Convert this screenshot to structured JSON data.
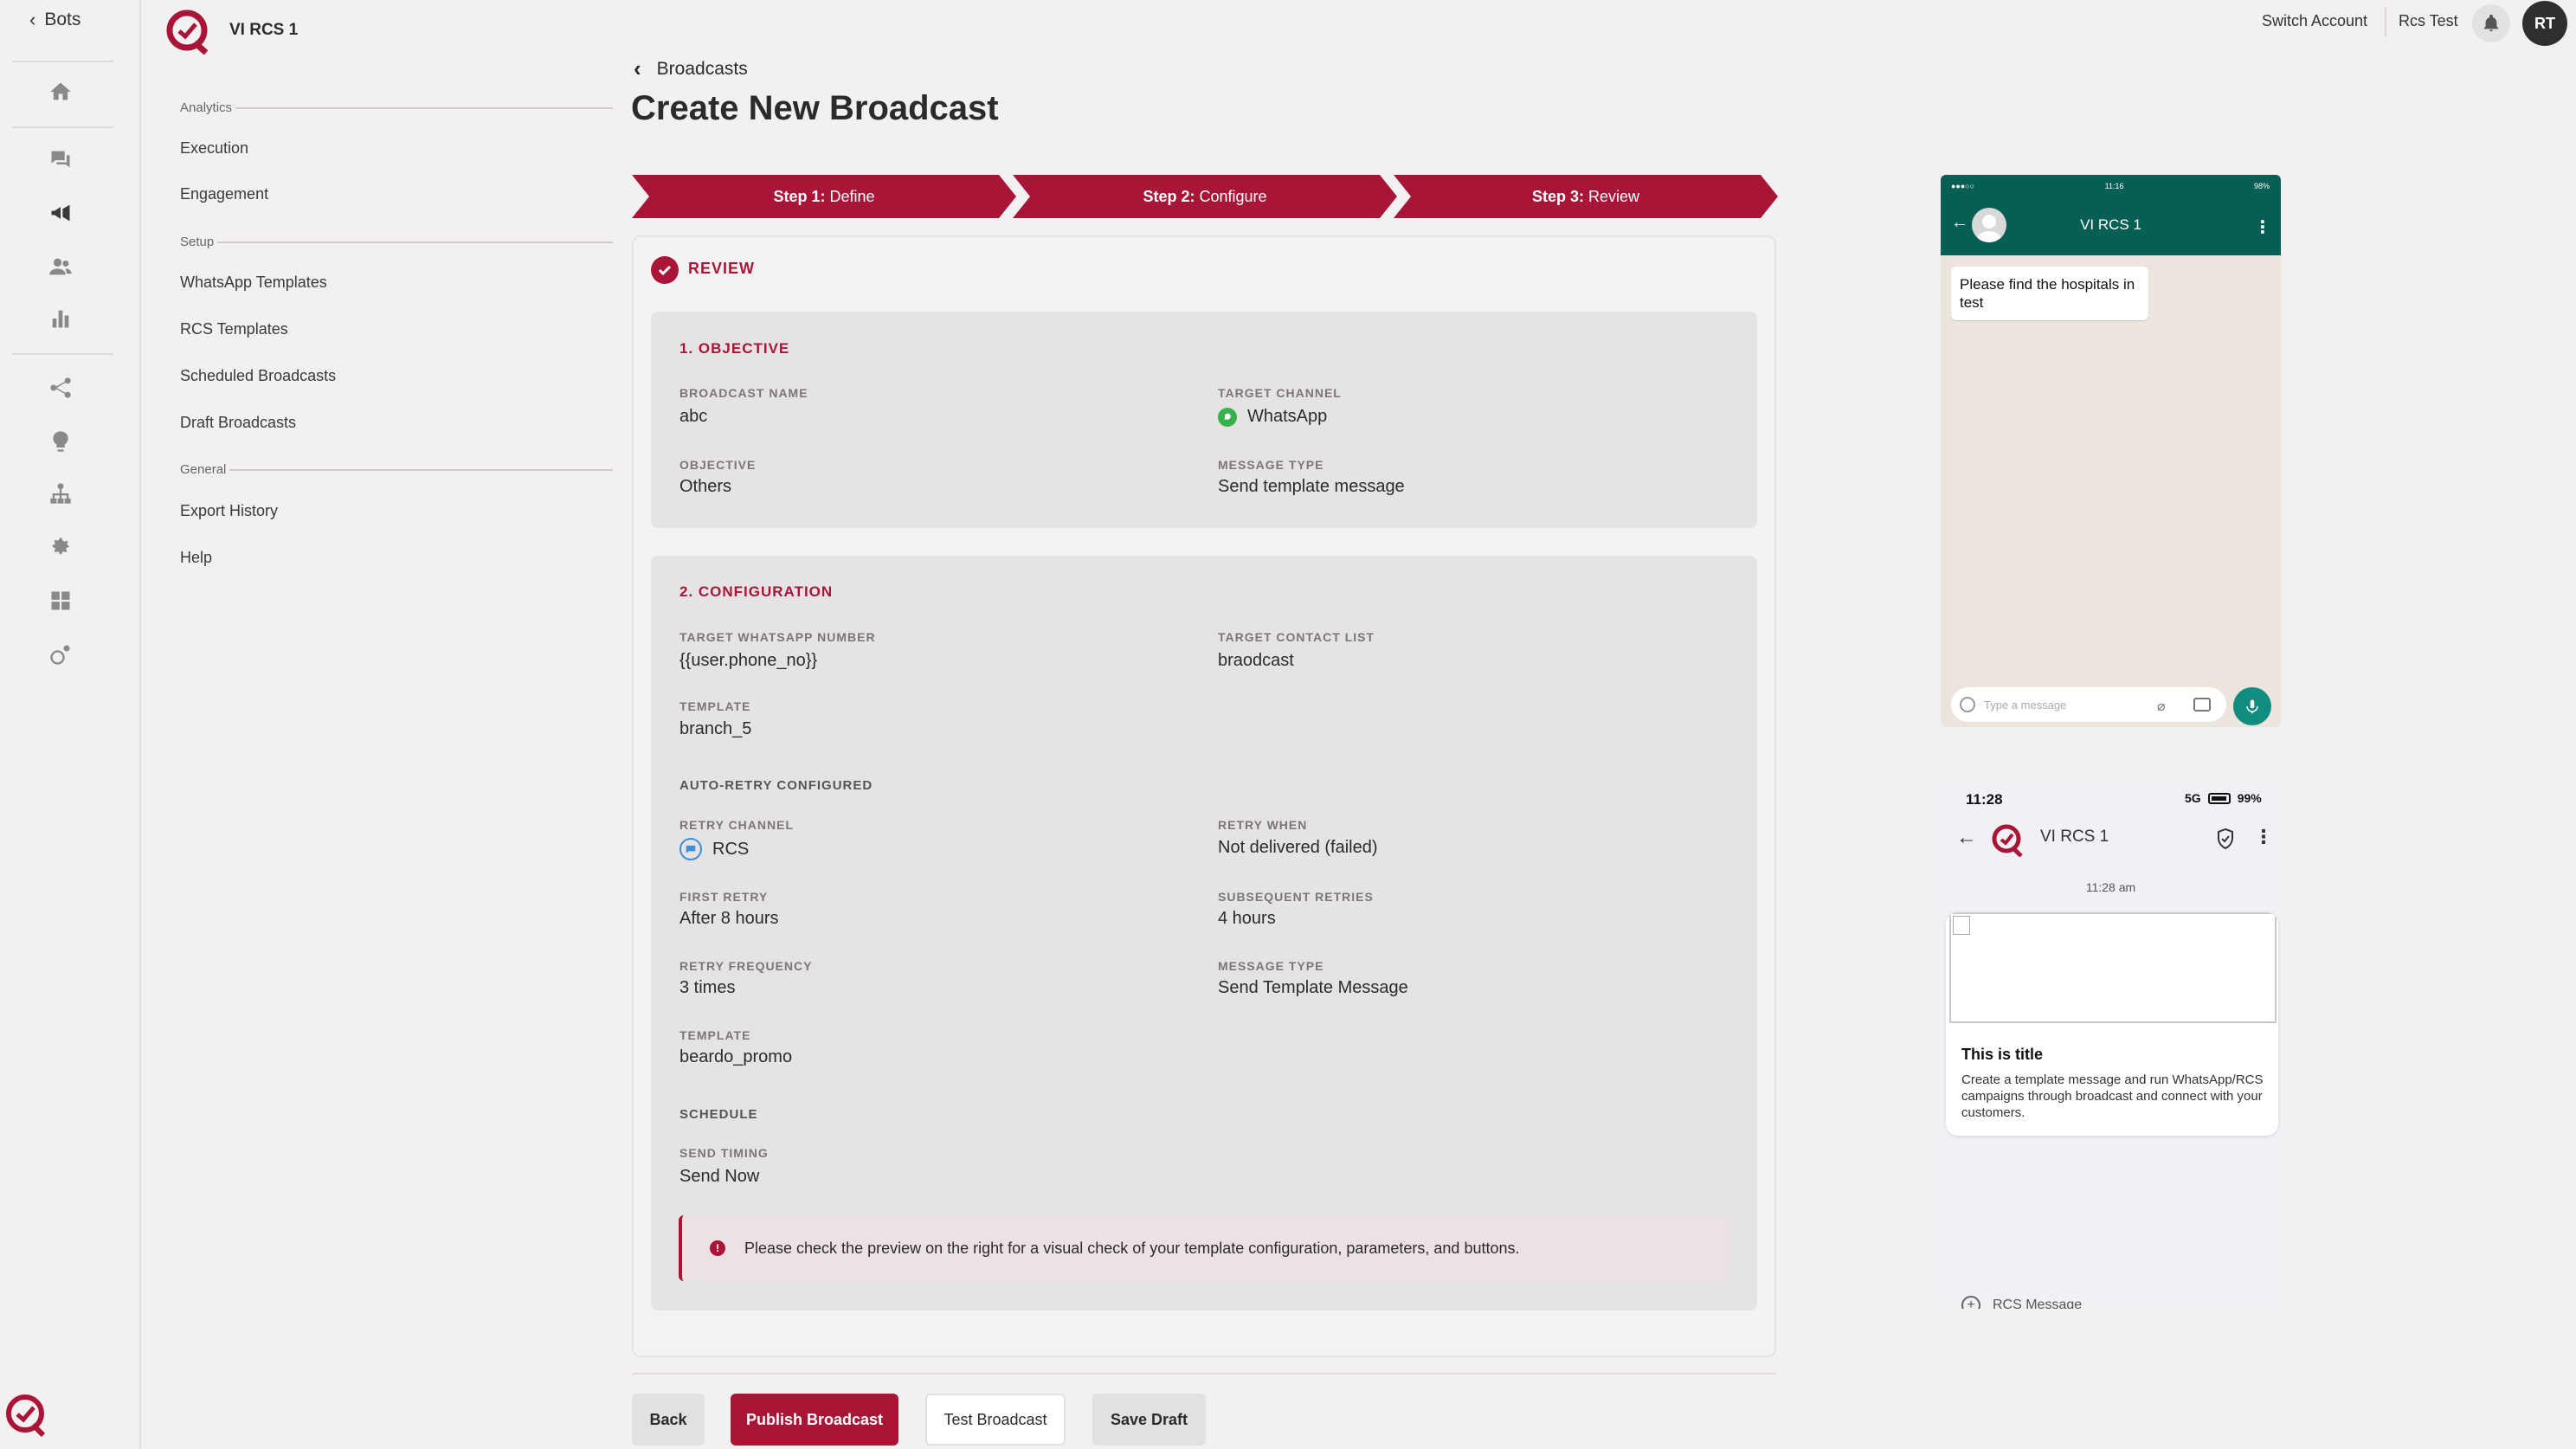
{
  "rail": {
    "back_label": "Bots"
  },
  "sidebar": {
    "bot_name": "VI RCS 1",
    "sections": {
      "analytics": "Analytics",
      "setup": "Setup",
      "general": "General"
    },
    "items": {
      "execution": "Execution",
      "engagement": "Engagement",
      "whatsapp_templates": "WhatsApp Templates",
      "rcs_templates": "RCS Templates",
      "scheduled_broadcasts": "Scheduled Broadcasts",
      "draft_broadcasts": "Draft Broadcasts",
      "export_history": "Export History",
      "help": "Help"
    }
  },
  "header": {
    "switch_account": "Switch Account",
    "account_name": "Rcs Test",
    "avatar_initials": "RT"
  },
  "main": {
    "breadcrumb": "Broadcasts",
    "title": "Create New Broadcast",
    "steps": [
      {
        "prefix": "Step 1:",
        "label": "Define"
      },
      {
        "prefix": "Step 2:",
        "label": "Configure"
      },
      {
        "prefix": "Step 3:",
        "label": "Review"
      }
    ],
    "review_title": "REVIEW",
    "objective": {
      "title": "1. OBJECTIVE",
      "broadcast_name_label": "BROADCAST NAME",
      "broadcast_name": "abc",
      "target_channel_label": "TARGET CHANNEL",
      "target_channel": "WhatsApp",
      "objective_label": "OBJECTIVE",
      "objective": "Others",
      "message_type_label": "MESSAGE TYPE",
      "message_type": "Send template message"
    },
    "configuration": {
      "title": "2. CONFIGURATION",
      "target_number_label": "TARGET WHATSAPP NUMBER",
      "target_number": "{{user.phone_no}}",
      "target_list_label": "TARGET CONTACT LIST",
      "target_list": "braodcast",
      "template_label": "TEMPLATE",
      "template": "branch_5",
      "auto_retry_heading": "AUTO-RETRY CONFIGURED",
      "retry_channel_label": "RETRY CHANNEL",
      "retry_channel": "RCS",
      "retry_when_label": "RETRY WHEN",
      "retry_when": "Not delivered (failed)",
      "first_retry_label": "FIRST RETRY",
      "first_retry": "After 8 hours",
      "subsequent_label": "SUBSEQUENT RETRIES",
      "subsequent": "4 hours",
      "frequency_label": "RETRY FREQUENCY",
      "frequency": "3 times",
      "retry_msg_type_label": "MESSAGE TYPE",
      "retry_msg_type": "Send Template Message",
      "retry_template_label": "TEMPLATE",
      "retry_template": "beardo_promo",
      "schedule_heading": "SCHEDULE",
      "send_timing_label": "SEND TIMING",
      "send_timing": "Send Now"
    },
    "alert": "Please check the preview on the right for a visual check of your template configuration, parameters, and buttons.",
    "buttons": {
      "back": "Back",
      "publish": "Publish Broadcast",
      "test": "Test Broadcast",
      "save_draft": "Save Draft"
    }
  },
  "whatsapp_preview": {
    "status_left": "●●●○○",
    "status_time": "11:16",
    "status_battery": "98%",
    "contact": "VI RCS 1",
    "message": "Please find the hospitals in test",
    "input_placeholder": "Type a message"
  },
  "rcs_preview": {
    "time": "11:28",
    "network": "5G",
    "battery": "99%",
    "contact": "VI RCS 1",
    "timestamp": "11:28 am",
    "card_title": "This is title",
    "card_desc": "Create a template message and run WhatsApp/RCS campaigns through broadcast and connect with your customers.",
    "compose_placeholder": "RCS Message"
  },
  "colors": {
    "brand": "#a91537",
    "whatsapp_green": "#075e54",
    "background": "#f2f0f1"
  }
}
